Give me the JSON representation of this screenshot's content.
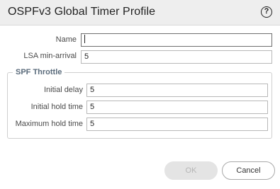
{
  "dialog": {
    "title": "OSPFv3 Global Timer Profile",
    "help_icon_glyph": "?"
  },
  "form": {
    "name": {
      "label": "Name",
      "value": ""
    },
    "lsa_min_arrival": {
      "label": "LSA min-arrival",
      "value": "5"
    }
  },
  "spf_throttle": {
    "legend": "SPF Throttle",
    "initial_delay": {
      "label": "Initial delay",
      "value": "5"
    },
    "initial_hold_time": {
      "label": "Initial hold time",
      "value": "5"
    },
    "maximum_hold_time": {
      "label": "Maximum hold time",
      "value": "5"
    }
  },
  "buttons": {
    "ok": {
      "label": "OK",
      "enabled": false
    },
    "cancel": {
      "label": "Cancel",
      "enabled": true
    }
  }
}
